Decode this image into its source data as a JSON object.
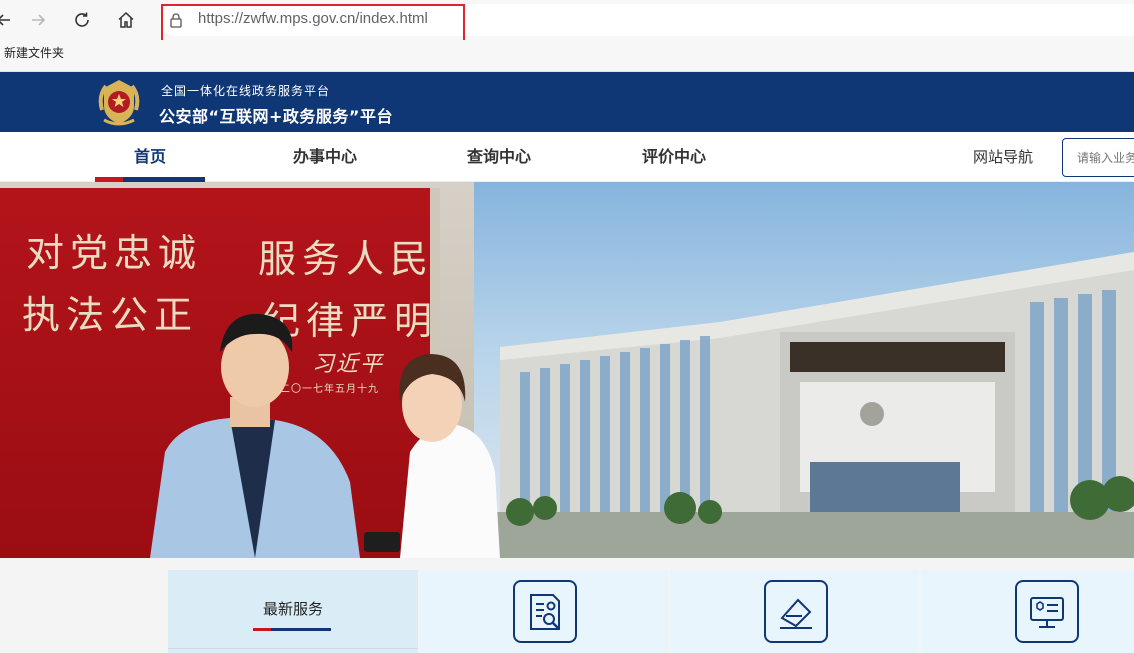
{
  "browser": {
    "url_host": "https://zwfw.mps.gov.cn",
    "url_path": "/index.html",
    "bookmark_folder": "新建文件夹",
    "icons": [
      "back-icon",
      "forward-icon",
      "reload-icon",
      "home-icon",
      "lock-icon"
    ]
  },
  "site": {
    "subtitle": "全国一体化在线政务服务平台",
    "title": "公安部“互联网+政务服务”平台",
    "brand_color": "#0f3775",
    "accent_color": "#c8161d"
  },
  "nav": {
    "items": [
      {
        "label": "首页",
        "active": true
      },
      {
        "label": "办事中心",
        "active": false
      },
      {
        "label": "查询中心",
        "active": false
      },
      {
        "label": "评价中心",
        "active": false
      }
    ],
    "site_guide": "网站导航",
    "search_placeholder": "请输入业务"
  },
  "banner": {
    "slogans": [
      "对党忠诚",
      "服务人民",
      "执法公正",
      "纪律严明"
    ],
    "signature": "习近平",
    "date_text": "二〇一七年五月十九"
  },
  "services": {
    "latest_title": "最新服务",
    "cards": [
      {
        "icon": "document-search-icon"
      },
      {
        "icon": "edit-pen-icon"
      },
      {
        "icon": "certificate-monitor-icon"
      }
    ]
  }
}
